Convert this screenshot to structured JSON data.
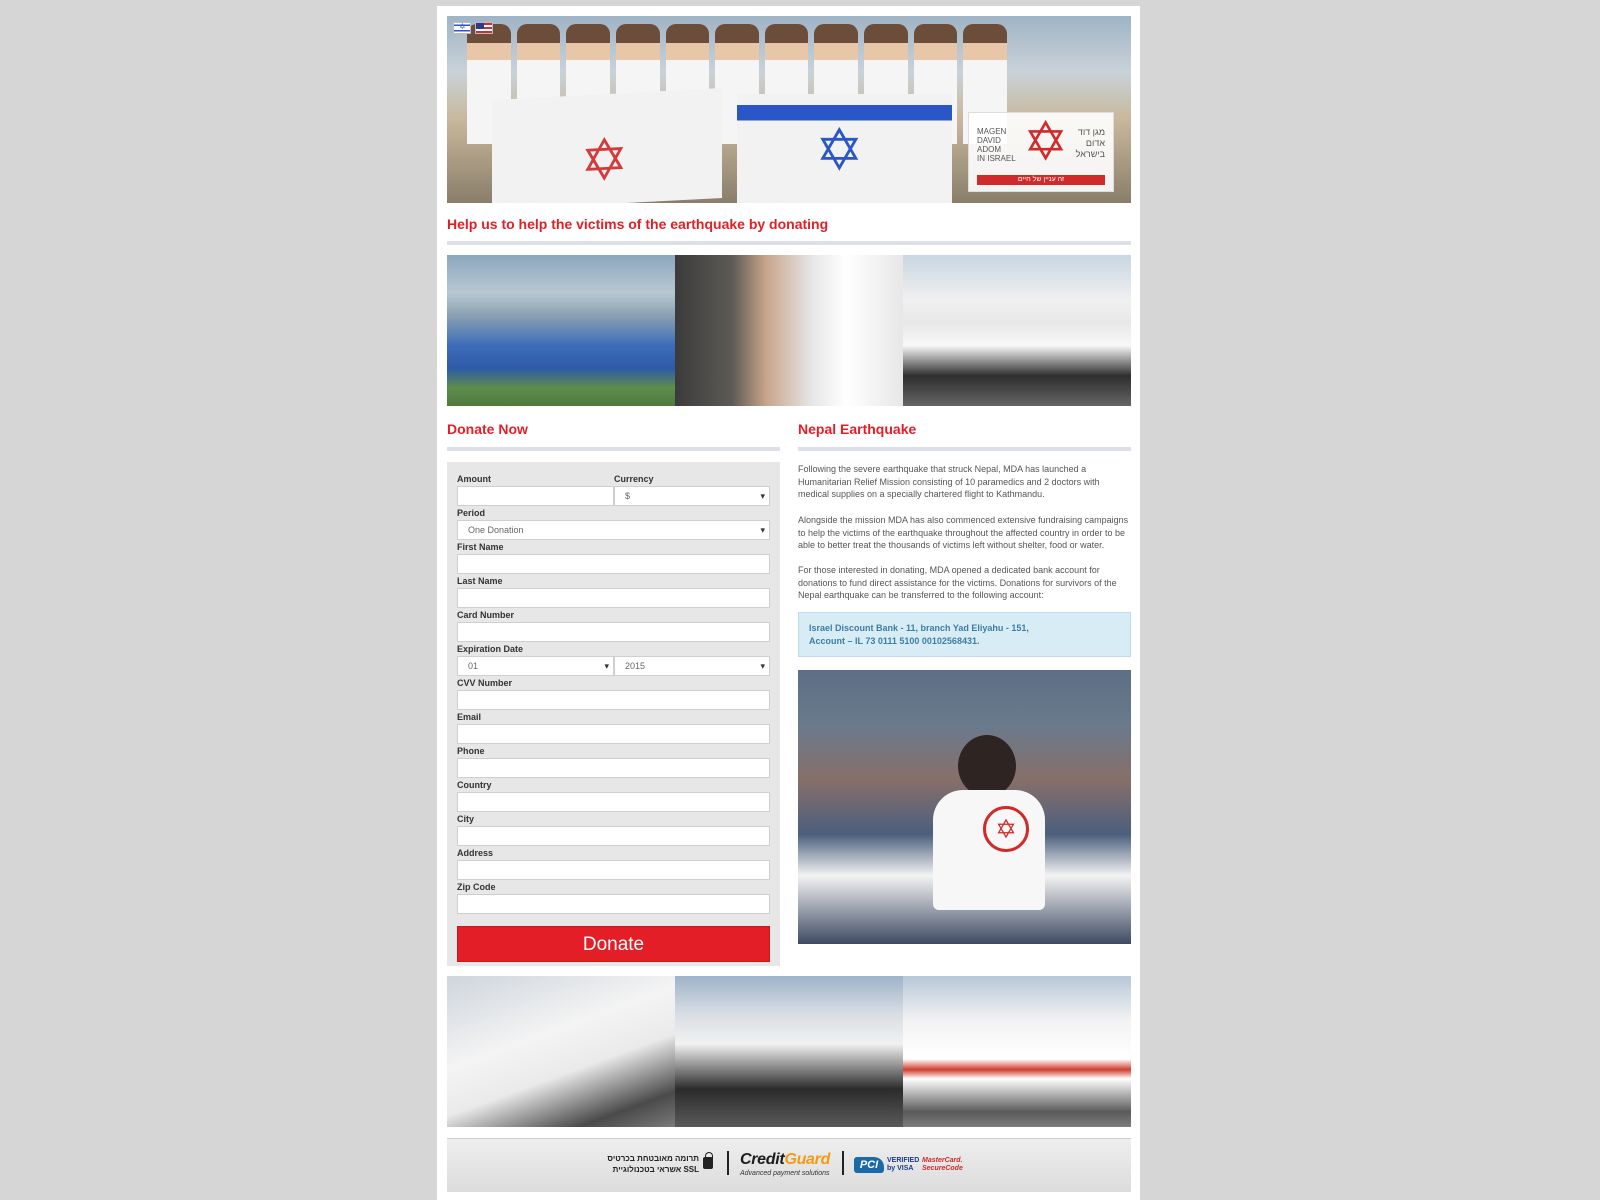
{
  "hero": {
    "flags": [
      "Hebrew",
      "English"
    ],
    "logo": {
      "english": "MAGEN\nDAVID\nADOM\nIN ISRAEL",
      "hebrew": "מגן דוד\nאדום\nבישראל",
      "tagline": "זה עניין של חיים"
    }
  },
  "headline": "Help us to help the victims of the earthquake by donating",
  "donate_section": {
    "title": "Donate Now",
    "fields": {
      "amount_label": "Amount",
      "currency_label": "Currency",
      "currency_value": "$",
      "period_label": "Period",
      "period_value": "One Donation",
      "first_name_label": "First Name",
      "last_name_label": "Last Name",
      "card_number_label": "Card Number",
      "expiration_label": "Expiration Date",
      "exp_month_value": "01",
      "exp_year_value": "2015",
      "cvv_label": "CVV Number",
      "email_label": "Email",
      "phone_label": "Phone",
      "country_label": "Country",
      "city_label": "City",
      "address_label": "Address",
      "zip_label": "Zip Code"
    },
    "button_label": "Donate"
  },
  "info_section": {
    "title": "Nepal Earthquake",
    "paragraphs": [
      "Following the severe earthquake that struck Nepal, MDA has launched a Humanitarian Relief Mission consisting of 10 paramedics and 2 doctors with medical supplies on a specially chartered flight to Kathmandu.",
      "Alongside the mission MDA has also commenced extensive fundraising campaigns to help the victims of the earthquake throughout the affected country in order to be able to better treat the thousands of victims left without shelter, food or water.",
      "For those interested in donating, MDA opened a dedicated bank account for donations to fund direct assistance for the victims. Donations for survivors of the Nepal earthquake can be transferred to the following account:"
    ],
    "bank_line1": "Israel Discount Bank - 11, branch Yad Eliyahu - 151,",
    "bank_line2": "Account – IL 73 0111 5100 00102568431."
  },
  "footer": {
    "hebrew_note": "תרומה מאובטחת בכרטיס אשראי בטכנולוגיית SSL",
    "creditguard_a": "Credit",
    "creditguard_b": "Guard",
    "creditguard_sub": "Advanced payment solutions",
    "pci": "PCI",
    "vbv_1": "VERIFIED",
    "vbv_2": "by VISA",
    "mc_1": "MasterCard.",
    "mc_2": "SecureCode"
  },
  "colors": {
    "accent": "#e41e26",
    "page_bg": "#d6d6d6",
    "form_bg": "#e7e7e7",
    "bank_bg": "#d8ecf6"
  },
  "icons": [
    "flag-israel-icon",
    "flag-usa-icon",
    "lock-icon",
    "star-of-david-icon"
  ]
}
